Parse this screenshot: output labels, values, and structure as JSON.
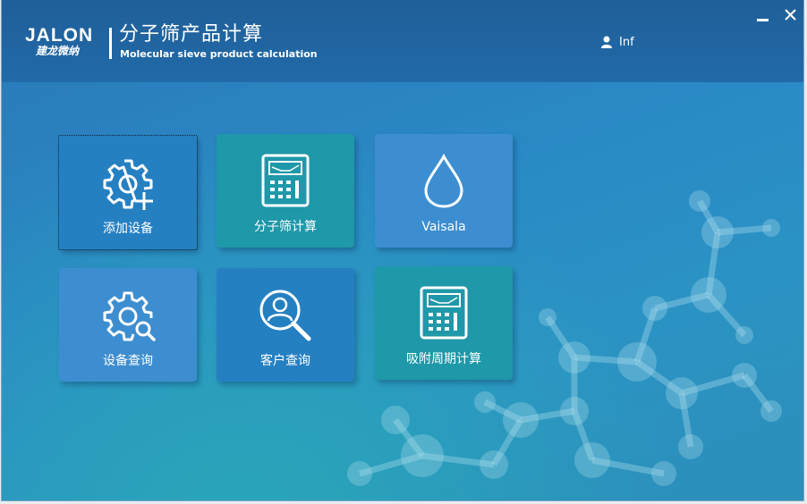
{
  "header": {
    "logo_en": "JALON",
    "logo_cn": "建龙微纳",
    "title_cn": "分子筛产品计算",
    "title_en": "Molecular sieve product calculation",
    "user_name": "Inf"
  },
  "tiles": [
    {
      "label": "添加设备",
      "icon": "gear-plus-icon"
    },
    {
      "label": "分子筛计算",
      "icon": "calculator-icon"
    },
    {
      "label": "Vaisala",
      "icon": "water-drop-icon"
    },
    {
      "label": "设备查询",
      "icon": "gear-search-icon"
    },
    {
      "label": "客户查询",
      "icon": "user-search-icon"
    },
    {
      "label": "吸附周期计算",
      "icon": "calculator-icon"
    }
  ],
  "colors": {
    "header": "#1f5f99",
    "background": "#2a8ac6",
    "tile_blue": "#2580c2",
    "tile_teal": "#1f98a9",
    "tile_light": "#3c8ed0"
  }
}
